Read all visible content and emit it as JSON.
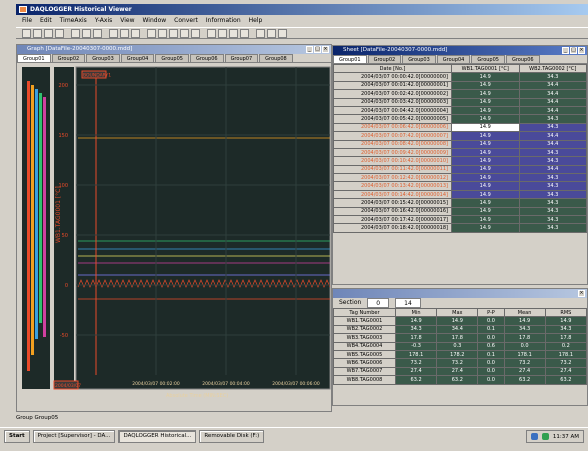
{
  "app": {
    "title": "DAQLOGGER Historical Viewer",
    "menu": [
      "File",
      "Edit",
      "TimeAxis",
      "Y-Axis",
      "View",
      "Window",
      "Convert",
      "Information",
      "Help"
    ]
  },
  "graph": {
    "title": "Graph [DataFile-20040307-0000.mdd]",
    "tabs": [
      "Group01",
      "Group02",
      "Group03",
      "Group04",
      "Group05",
      "Group06",
      "Group07",
      "Group08"
    ],
    "y_label": "WB1.TAG0001 [°C]",
    "y_ticks": [
      "200",
      "150",
      "100",
      "50",
      "0",
      "-50"
    ],
    "x_ticks": [
      "2004/03/07 00:02:00",
      "2004/03/07 00:04:00",
      "2004/03/07 00:06:00"
    ],
    "x_label": "Absolute Time (MIN:SEC)",
    "boundary_label": "BOUNDARY1",
    "corner_label": "2004/03/07"
  },
  "sheet": {
    "title": "Sheet [DataFile-20040307-0000.mdd]",
    "tabs": [
      "Group01",
      "Group02",
      "Group03",
      "Group04",
      "Group05",
      "Group06"
    ],
    "columns": [
      "Date [No.]",
      "WB1.TAG0001 [°C]",
      "WB2.TAG0002 [°C]"
    ],
    "rows": [
      {
        "date": "2004/03/07 00:00:42.0[00000000]",
        "v1": "14.9",
        "v2": "34.3",
        "hl": false
      },
      {
        "date": "2004/03/07 00:01:42.0[00000001]",
        "v1": "14.9",
        "v2": "34.4",
        "hl": false
      },
      {
        "date": "2004/03/07 00:02:42.0[00000002]",
        "v1": "14.9",
        "v2": "34.4",
        "hl": false
      },
      {
        "date": "2004/03/07 00:03:42.0[00000003]",
        "v1": "14.9",
        "v2": "34.4",
        "hl": false
      },
      {
        "date": "2004/03/07 00:04:42.0[00000004]",
        "v1": "14.9",
        "v2": "34.4",
        "hl": false
      },
      {
        "date": "2004/03/07 00:05:42.0[00000005]",
        "v1": "14.9",
        "v2": "34.3",
        "hl": false
      },
      {
        "date": "2004/03/07 00:06:42.0[00000006]",
        "v1": "14.9",
        "v2": "34.3",
        "hl": true,
        "cur": true
      },
      {
        "date": "2004/03/07 00:07:42.0[00000007]",
        "v1": "14.9",
        "v2": "34.4",
        "hl": true
      },
      {
        "date": "2004/03/07 00:08:42.0[00000008]",
        "v1": "14.9",
        "v2": "34.4",
        "hl": true
      },
      {
        "date": "2004/03/07 00:09:42.0[00000009]",
        "v1": "14.9",
        "v2": "34.3",
        "hl": true
      },
      {
        "date": "2004/03/07 00:10:42.0[00000010]",
        "v1": "14.9",
        "v2": "34.3",
        "hl": true
      },
      {
        "date": "2004/03/07 00:11:42.0[00000011]",
        "v1": "14.9",
        "v2": "34.4",
        "hl": true
      },
      {
        "date": "2004/03/07 00:12:42.0[00000012]",
        "v1": "14.9",
        "v2": "34.3",
        "hl": true
      },
      {
        "date": "2004/03/07 00:13:42.0[00000013]",
        "v1": "14.9",
        "v2": "34.3",
        "hl": true
      },
      {
        "date": "2004/03/07 00:14:42.0[00000014]",
        "v1": "14.9",
        "v2": "34.3",
        "hl": true
      },
      {
        "date": "2004/03/07 00:15:42.0[00000015]",
        "v1": "14.9",
        "v2": "34.3",
        "hl": false
      },
      {
        "date": "2004/03/07 00:16:42.0[00000016]",
        "v1": "14.9",
        "v2": "34.3",
        "hl": false
      },
      {
        "date": "2004/03/07 00:17:42.0[00000017]",
        "v1": "14.9",
        "v2": "34.3",
        "hl": false
      },
      {
        "date": "2004/03/07 00:18:42.0[00000018]",
        "v1": "14.9",
        "v2": "34.3",
        "hl": false
      }
    ]
  },
  "stats": {
    "section_label": "Section",
    "section_from": "0",
    "section_to": "14",
    "columns": [
      "Tag Number",
      "Min",
      "Max",
      "P-P",
      "Mean",
      "RMS"
    ],
    "rows": [
      {
        "tag": "WB1.TAG0001",
        "min": "14.9",
        "max": "14.9",
        "pp": "0.0",
        "mean": "14.9",
        "rms": "14.9"
      },
      {
        "tag": "WB2.TAG0002",
        "min": "34.3",
        "max": "34.4",
        "pp": "0.1",
        "mean": "34.3",
        "rms": "34.3"
      },
      {
        "tag": "WB3.TAG0003",
        "min": "17.8",
        "max": "17.8",
        "pp": "0.0",
        "mean": "17.8",
        "rms": "17.8"
      },
      {
        "tag": "WB4.TAG0004",
        "min": "-0.3",
        "max": "0.3",
        "pp": "0.6",
        "mean": "0.0",
        "rms": "0.2"
      },
      {
        "tag": "WB5.TAG0005",
        "min": "178.1",
        "max": "178.2",
        "pp": "0.1",
        "mean": "178.1",
        "rms": "178.1"
      },
      {
        "tag": "WB6.TAG0006",
        "min": "73.2",
        "max": "73.2",
        "pp": "0.0",
        "mean": "73.2",
        "rms": "73.2"
      },
      {
        "tag": "WB7.TAG0007",
        "min": "27.4",
        "max": "27.4",
        "pp": "0.0",
        "mean": "27.4",
        "rms": "27.4"
      },
      {
        "tag": "WB8.TAG0008",
        "min": "63.2",
        "max": "63.2",
        "pp": "0.0",
        "mean": "63.2",
        "rms": "63.2"
      }
    ]
  },
  "status": "Group Group05",
  "taskbar": {
    "start": "Start",
    "items": [
      "Project [Supervisor] - DA...",
      "DAQLOGGER Historical...",
      "Removable Disk (F:)"
    ],
    "clock": "11:37 AM"
  }
}
